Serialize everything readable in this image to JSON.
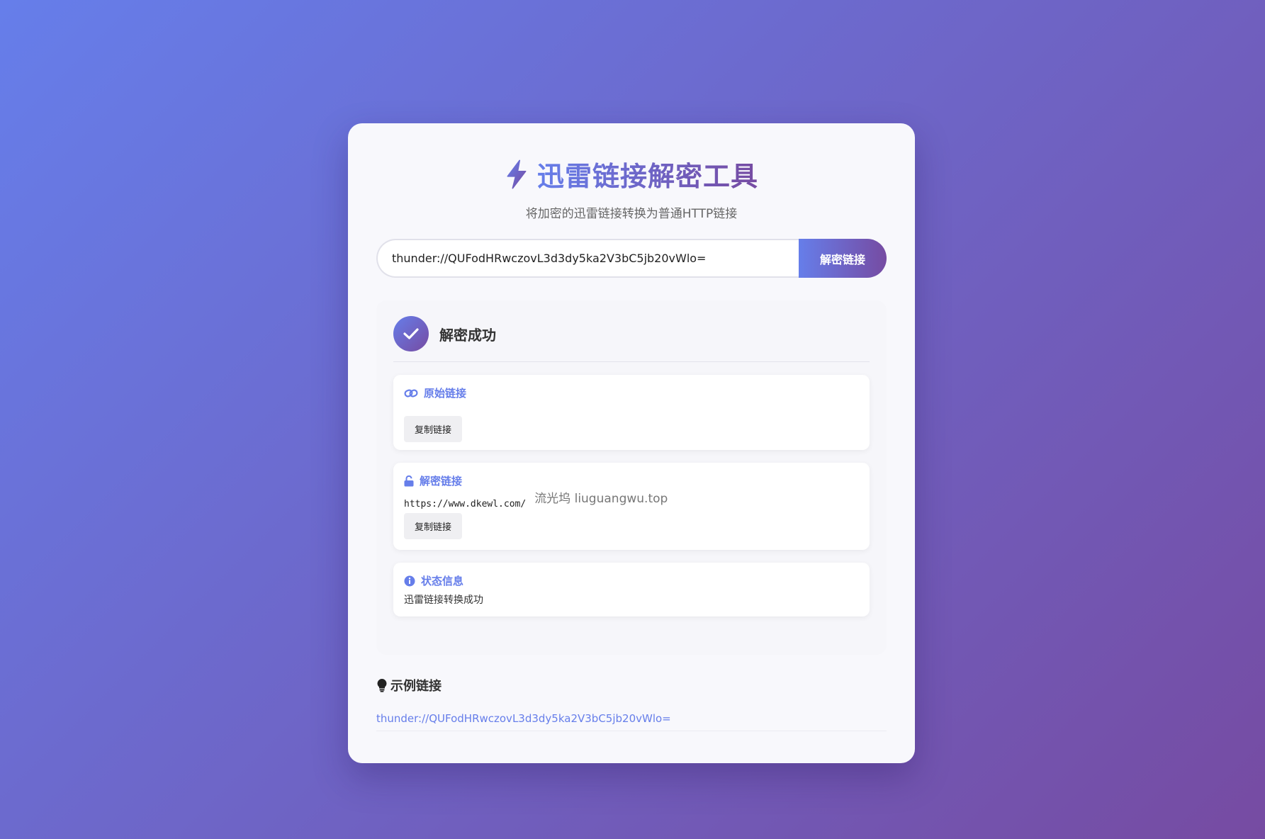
{
  "header": {
    "icon": "lightning-bolt-icon",
    "title": "迅雷链接解密工具",
    "subtitle": "将加密的迅雷链接转换为普通HTTP链接"
  },
  "form": {
    "input_value": "thunder://QUFodHRwczovL3d3dy5ka2V3bC5jb20vWlo=",
    "button_label": "解密链接"
  },
  "result": {
    "icon": "check-icon",
    "title": "解密成功",
    "original": {
      "icon": "link-icon",
      "label": "原始链接",
      "value": "",
      "copy_label": "复制链接"
    },
    "decrypted": {
      "icon": "unlock-icon",
      "label": "解密链接",
      "value": "https://www.dkewl.com/",
      "watermark": "流光坞 liuguangwu.top",
      "copy_label": "复制链接"
    },
    "status": {
      "icon": "info-icon",
      "label": "状态信息",
      "text": "迅雷链接转换成功"
    }
  },
  "examples": {
    "icon": "lightbulb-icon",
    "title": "示例链接",
    "items": [
      "thunder://QUFodHRwczovL3d3dy5ka2V3bC5jb20vWlo="
    ]
  },
  "colors": {
    "accent_start": "#667eea",
    "accent_end": "#764ba2"
  }
}
